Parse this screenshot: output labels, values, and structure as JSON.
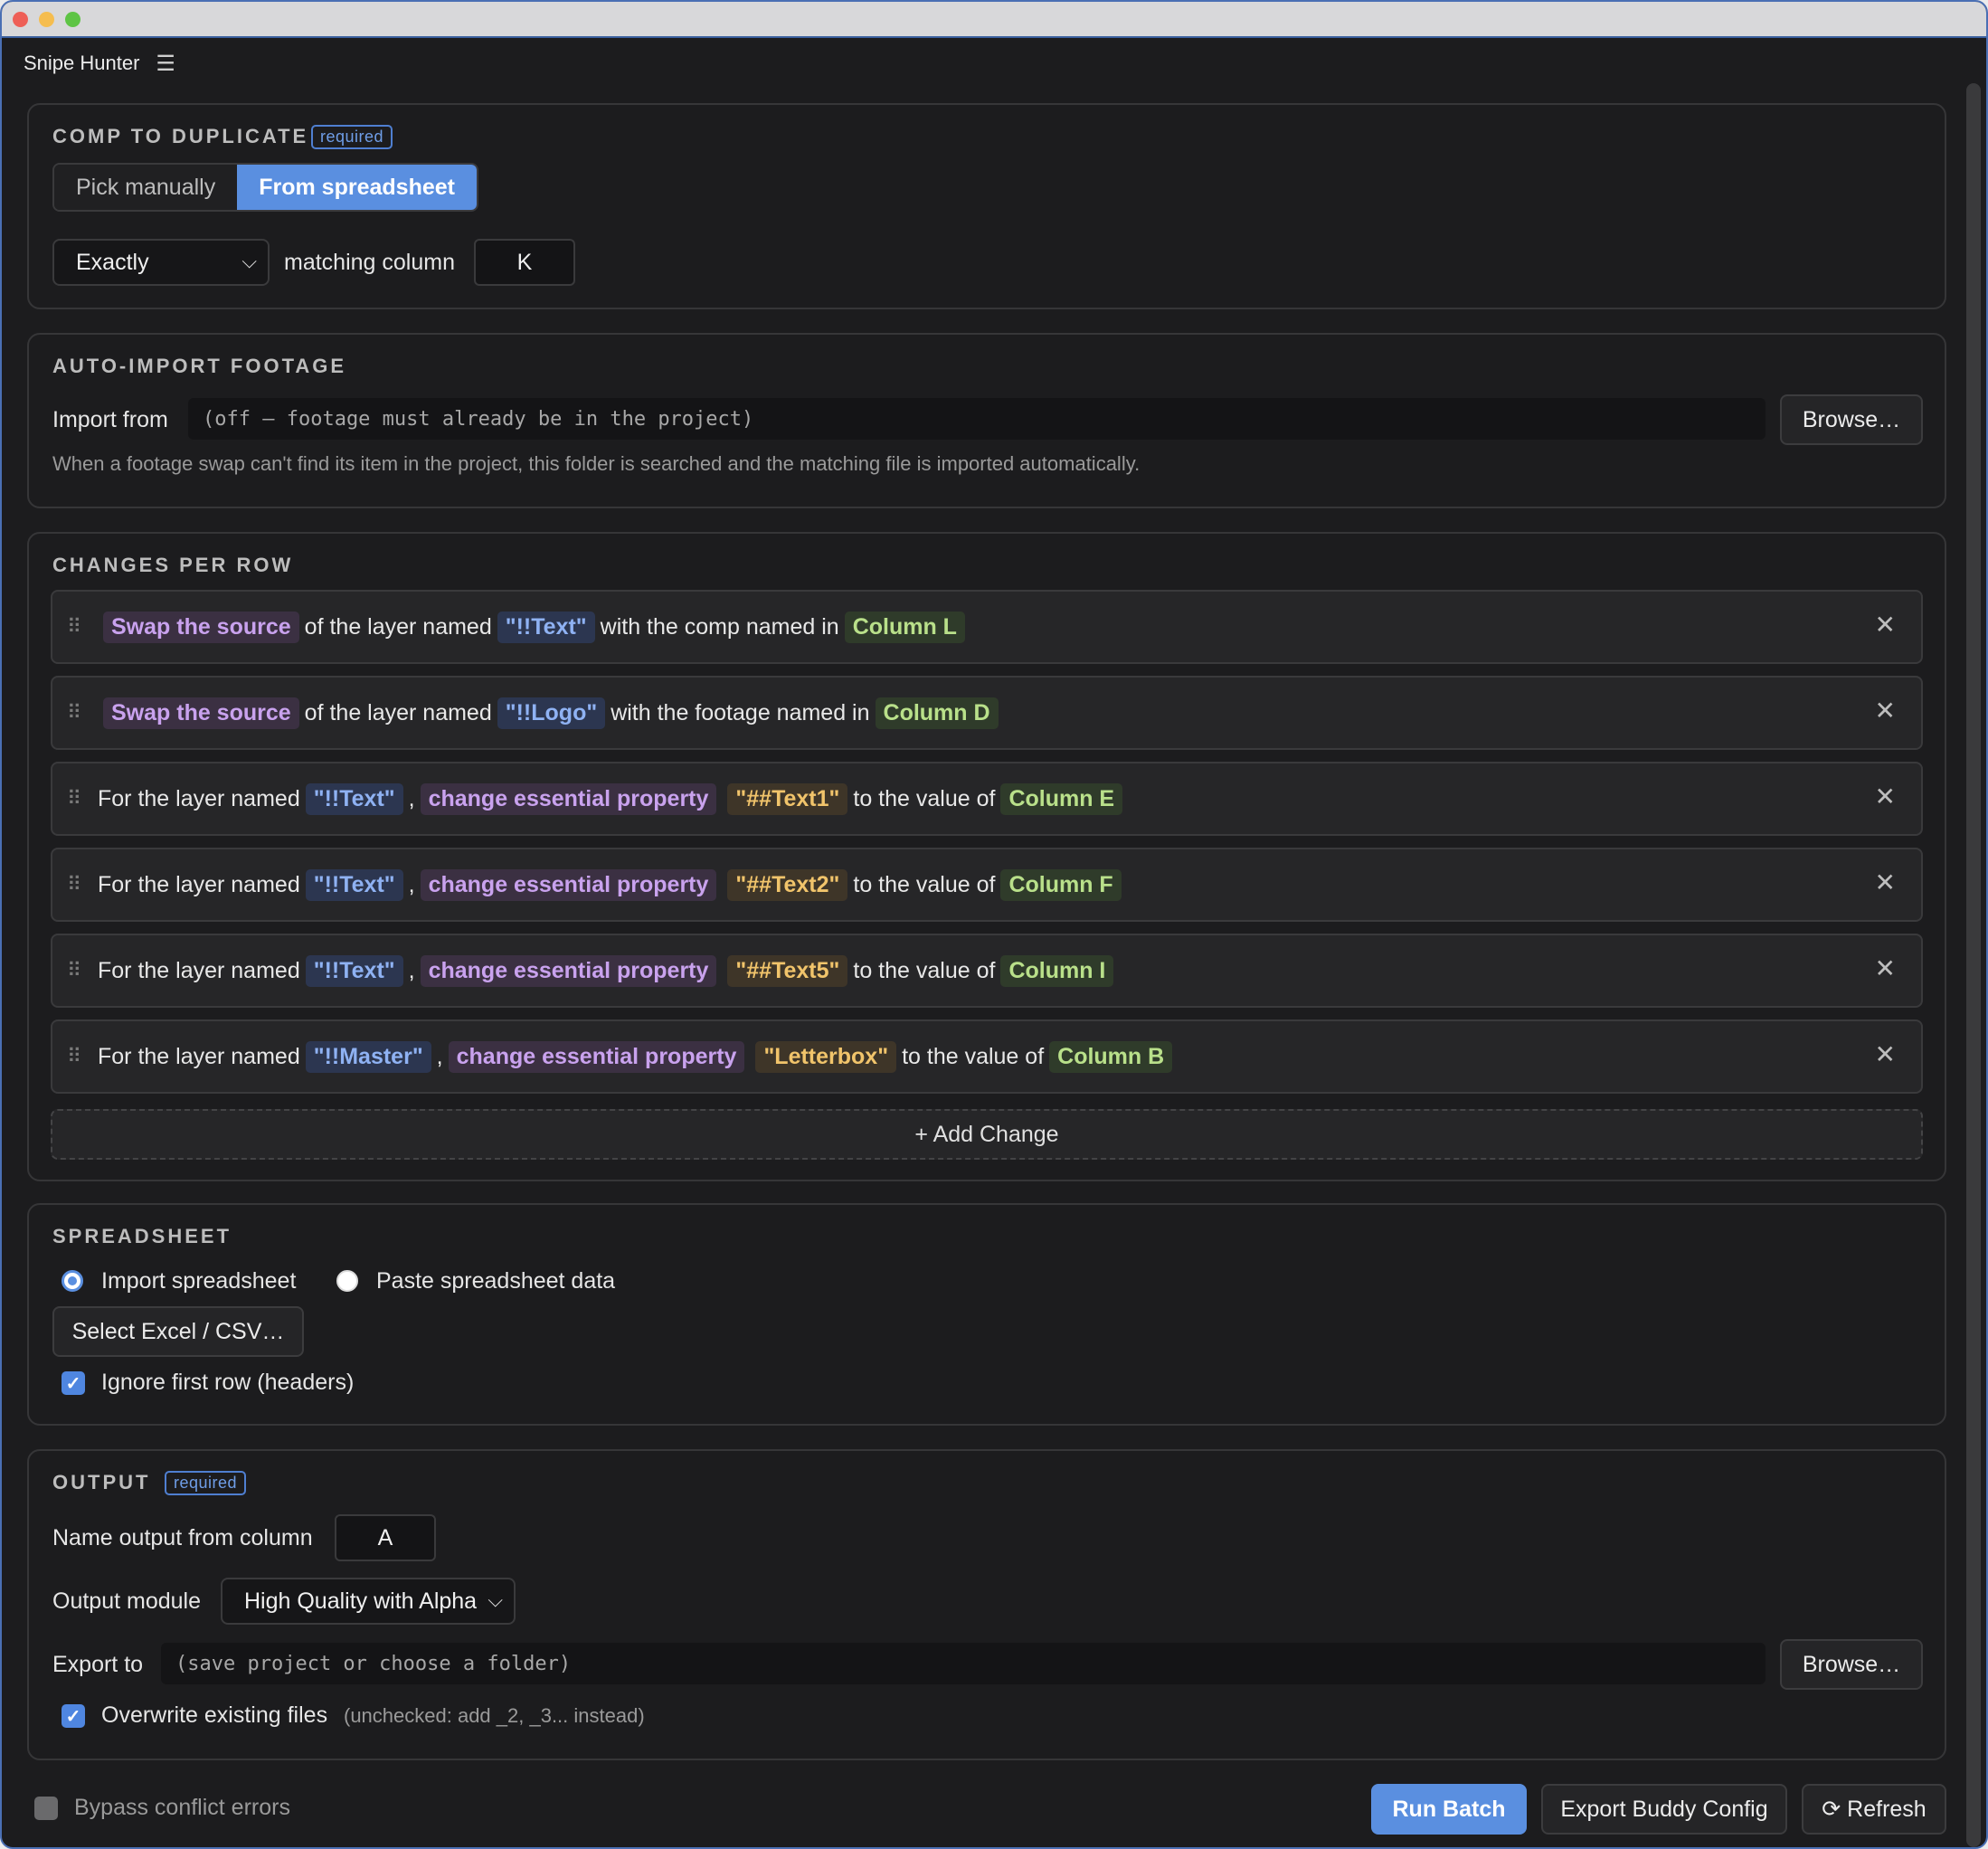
{
  "window": {
    "title": "Snipe Hunter",
    "menu_icon": "hamburger-icon"
  },
  "comp": {
    "title": "COMP TO DUPLICATE",
    "badge": "required",
    "tabs": [
      "Pick manually",
      "From spreadsheet"
    ],
    "active_tab": "From spreadsheet",
    "match_mode": "Exactly",
    "matching_label": "matching column",
    "matching_column": "K"
  },
  "footage": {
    "title": "AUTO-IMPORT FOOTAGE",
    "import_label": "Import from",
    "import_value": "(off — footage must already be in the project)",
    "browse_label": "Browse…",
    "hint": "When a footage swap can't find its item in the project, this folder is searched and the matching file is imported automatically."
  },
  "changes": {
    "title": "CHANGES PER ROW",
    "rows": [
      {
        "pre": "",
        "action": "Swap the source",
        "mid1": "of the layer named",
        "layer": "\"!!Text\"",
        "comma": "",
        "prop": "",
        "mid2": "with the comp named in",
        "column": "Column L"
      },
      {
        "pre": "",
        "action": "Swap the source",
        "mid1": "of the layer named",
        "layer": "\"!!Logo\"",
        "comma": "",
        "prop": "",
        "mid2": "with the footage named in",
        "column": "Column D"
      },
      {
        "pre": "For the layer named",
        "layer": "\"!!Text\"",
        "comma": ",",
        "action": "change essential property",
        "prop": "\"##Text1\"",
        "mid2": "to the value of",
        "column": "Column E"
      },
      {
        "pre": "For the layer named",
        "layer": "\"!!Text\"",
        "comma": ",",
        "action": "change essential property",
        "prop": "\"##Text2\"",
        "mid2": "to the value of",
        "column": "Column F"
      },
      {
        "pre": "For the layer named",
        "layer": "\"!!Text\"",
        "comma": ",",
        "action": "change essential property",
        "prop": "\"##Text5\"",
        "mid2": "to the value of",
        "column": "Column I"
      },
      {
        "pre": "For the layer named",
        "layer": "\"!!Master\"",
        "comma": ",",
        "action": "change essential property",
        "prop": "\"Letterbox\"",
        "mid2": "to the value of",
        "column": "Column B"
      }
    ],
    "add_label": "+ Add Change",
    "remove_glyph": "✕",
    "grip_glyph": "⠿"
  },
  "spreadsheet": {
    "title": "SPREADSHEET",
    "radio_import": "Import spreadsheet",
    "radio_paste": "Paste spreadsheet data",
    "selected": "import",
    "select_button": "Select Excel / CSV…",
    "ignore_first_row": "Ignore first row (headers)",
    "ignore_first_row_checked": true
  },
  "output": {
    "title": "OUTPUT",
    "badge": "required",
    "name_label": "Name output from column",
    "name_column": "A",
    "module_label": "Output module",
    "module_value": "High Quality with Alpha",
    "export_label": "Export to",
    "export_value": "(save project or choose a folder)",
    "browse_label": "Browse…",
    "overwrite_label": "Overwrite existing files",
    "overwrite_hint": "(unchecked: add _2, _3... instead)",
    "overwrite_checked": true
  },
  "footer": {
    "bypass_label": "Bypass conflict errors",
    "bypass_checked": false,
    "run_label": "Run Batch",
    "export_config_label": "Export Buddy Config",
    "refresh_label": "⟳ Refresh"
  },
  "colors": {
    "accent": "#5a8fe0",
    "action_chip": "#c9a2ee",
    "layer_chip": "#8fb2f3",
    "prop_chip": "#f1c46b",
    "column_chip": "#b9e08a"
  }
}
